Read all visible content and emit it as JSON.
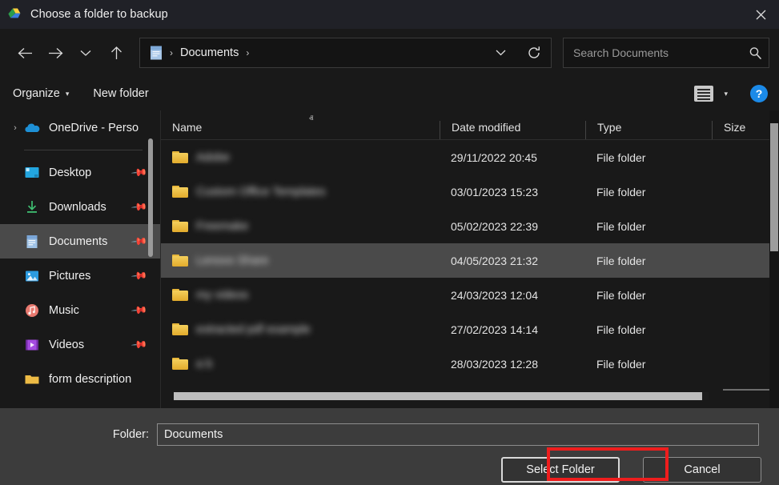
{
  "window": {
    "title": "Choose a folder to backup",
    "app_icon": "google-drive-icon",
    "close_label": "✕",
    "titlebar_color": "#202127"
  },
  "navigation": {
    "back_label": "←",
    "forward_label": "→",
    "recent_label": "∨",
    "up_label": "↑",
    "breadcrumb": {
      "icon": "documents-folder-icon",
      "separator": "›",
      "items": [
        "Documents"
      ],
      "trailing_separator": "›"
    },
    "address_chevron": "∨",
    "refresh_label": "⟳"
  },
  "search": {
    "placeholder": "Search Documents",
    "value": "",
    "icon": "search-icon"
  },
  "command_bar": {
    "organize_label": "Organize",
    "organize_caret": "▾",
    "new_folder_label": "New folder",
    "view_mode_icon": "list-view-icon",
    "view_caret": "▾",
    "help_label": "?",
    "help_color": "#1b8ae8"
  },
  "sidebar": {
    "items": [
      {
        "label": "OneDrive - Perso",
        "icon": "onedrive-cloud-icon",
        "expander": "›",
        "pinned": false,
        "selected": false,
        "divider_after": true
      },
      {
        "label": "Desktop",
        "icon": "desktop-icon",
        "expander": "",
        "pinned": true,
        "selected": false,
        "divider_after": false
      },
      {
        "label": "Downloads",
        "icon": "downloads-icon",
        "expander": "",
        "pinned": true,
        "selected": false,
        "divider_after": false
      },
      {
        "label": "Documents",
        "icon": "documents-icon",
        "expander": "",
        "pinned": true,
        "selected": true,
        "divider_after": false
      },
      {
        "label": "Pictures",
        "icon": "pictures-icon",
        "expander": "",
        "pinned": true,
        "selected": false,
        "divider_after": false
      },
      {
        "label": "Music",
        "icon": "music-icon",
        "expander": "",
        "pinned": true,
        "selected": false,
        "divider_after": false
      },
      {
        "label": "Videos",
        "icon": "videos-icon",
        "expander": "",
        "pinned": true,
        "selected": false,
        "divider_after": false
      },
      {
        "label": "form description",
        "icon": "folder-icon",
        "expander": "",
        "pinned": false,
        "selected": false,
        "divider_after": false
      }
    ],
    "pin_glyph": "📌"
  },
  "file_list": {
    "columns": [
      "Name",
      "Date modified",
      "Type",
      "Size"
    ],
    "sort_column": "Name",
    "sort_caret": "ⱏ",
    "rows": [
      {
        "name": "",
        "name_redacted": true,
        "name_width": 75,
        "date": "29/11/2022 20:45",
        "type": "File folder",
        "size": "",
        "selected": false
      },
      {
        "name": "",
        "name_redacted": true,
        "name_width": 200,
        "date": "03/01/2023 15:23",
        "type": "File folder",
        "size": "",
        "selected": false
      },
      {
        "name": "",
        "name_redacted": true,
        "name_width": 85,
        "date": "05/02/2023 22:39",
        "type": "File folder",
        "size": "",
        "selected": false
      },
      {
        "name": "",
        "name_redacted": true,
        "name_width": 110,
        "date": "04/05/2023 21:32",
        "type": "File folder",
        "size": "",
        "selected": true
      },
      {
        "name": "",
        "name_redacted": true,
        "name_width": 100,
        "date": "24/03/2023 12:04",
        "type": "File folder",
        "size": "",
        "selected": false
      },
      {
        "name": "",
        "name_redacted": true,
        "name_width": 157,
        "date": "27/02/2023 14:14",
        "type": "File folder",
        "size": "",
        "selected": false
      },
      {
        "name": "",
        "name_redacted": true,
        "name_width": 42,
        "date": "28/03/2023 12:28",
        "type": "File folder",
        "size": "",
        "selected": false
      }
    ]
  },
  "footer": {
    "folder_label": "Folder:",
    "folder_value": "Documents",
    "select_button": "Select Folder",
    "cancel_button": "Cancel",
    "highlight_color": "#ef1d1d"
  }
}
